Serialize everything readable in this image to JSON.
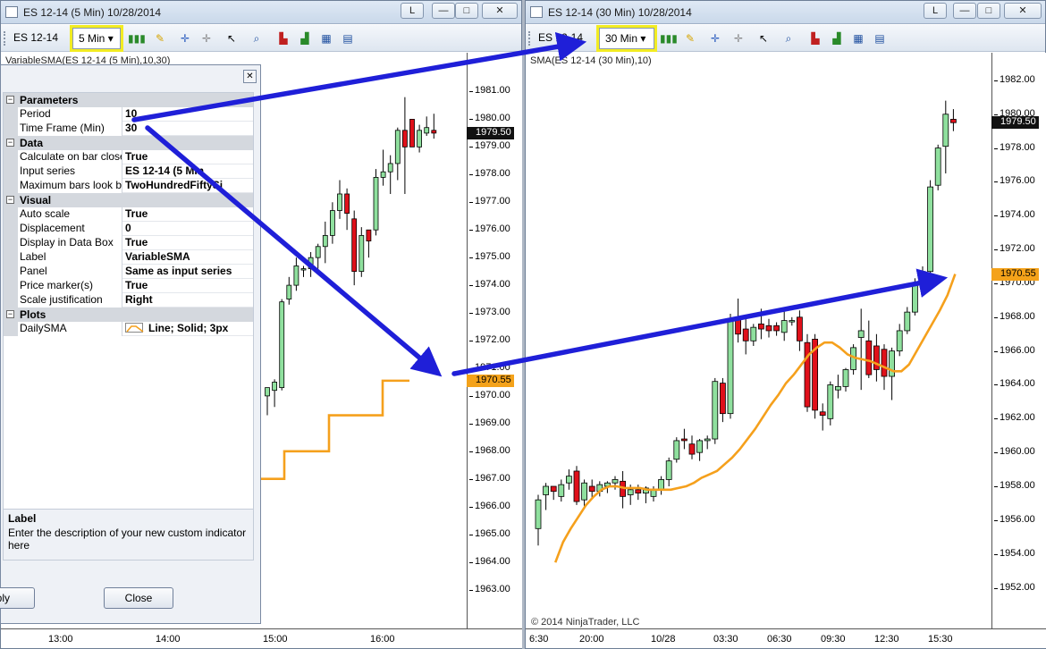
{
  "colors": {
    "bull": "#8fe09e",
    "bear": "#e0101a",
    "sma": "#f5a01c",
    "arrow": "#1f1fd8",
    "highlight": "#f2ec22"
  },
  "left_window": {
    "title": "ES 12-14 (5 Min)  10/28/2014",
    "title_buttons": {
      "layout": "L",
      "minimize": "—",
      "maximize": "□",
      "close": "✕"
    },
    "instrument": "ES 12-14",
    "timeframe": "5 Min",
    "indicator_label": "VariableSMA(ES 12-14 (5 Min),10,30)",
    "price_marker_close": "1979.50",
    "price_marker_sma": "1970.55",
    "y_ticks": [
      "1981.00",
      "1980.00",
      "1979.00",
      "1978.00",
      "1977.00",
      "1976.00",
      "1975.00",
      "1974.00",
      "1973.00",
      "1972.00",
      "1971.00",
      "1970.00",
      "1969.00",
      "1968.00",
      "1967.00",
      "1966.00",
      "1965.00",
      "1964.00",
      "1963.00"
    ],
    "x_ticks": [
      "13:00",
      "14:00",
      "15:00",
      "16:00"
    ]
  },
  "right_window": {
    "title": "ES 12-14 (30 Min)  10/28/2014",
    "title_buttons": {
      "layout": "L",
      "minimize": "—",
      "maximize": "□",
      "close": "✕"
    },
    "instrument": "ES 12-14",
    "timeframe": "30 Min",
    "indicator_label": "SMA(ES 12-14 (30 Min),10)",
    "price_marker_close": "1979.50",
    "price_marker_sma": "1970.55",
    "copyright": "© 2014 NinjaTrader, LLC",
    "y_ticks": [
      "1982.00",
      "1980.00",
      "1978.00",
      "1976.00",
      "1974.00",
      "1972.00",
      "1970.00",
      "1968.00",
      "1966.00",
      "1964.00",
      "1962.00",
      "1960.00",
      "1958.00",
      "1956.00",
      "1954.00",
      "1952.00"
    ],
    "x_ticks": [
      "6:30",
      "20:00",
      "10/28",
      "03:30",
      "06:30",
      "09:30",
      "12:30",
      "15:30"
    ]
  },
  "toolbar_icons": [
    "bar-style-icon",
    "drawing-pencil-icon",
    "crosshair-icon",
    "global-crosshair-icon",
    "pointer-icon",
    "zoom-icon",
    "indicators-icon",
    "strategies-icon",
    "chart-properties-icon",
    "data-box-icon"
  ],
  "dialog": {
    "close_label": "✕",
    "categories": [
      {
        "name": "Parameters",
        "rows": [
          {
            "label": "Period",
            "value": "10"
          },
          {
            "label": "Time Frame (Min)",
            "value": "30"
          }
        ]
      },
      {
        "name": "Data",
        "rows": [
          {
            "label": "Calculate on bar close",
            "value": "True"
          },
          {
            "label": "Input series",
            "value": "ES 12-14 (5 Min"
          },
          {
            "label": "Maximum bars look ba",
            "value": "TwoHundredFiftySi"
          }
        ]
      },
      {
        "name": "Visual",
        "rows": [
          {
            "label": "Auto scale",
            "value": "True"
          },
          {
            "label": "Displacement",
            "value": "0"
          },
          {
            "label": "Display in Data Box",
            "value": "True"
          },
          {
            "label": "Label",
            "value": "VariableSMA"
          },
          {
            "label": "Panel",
            "value": "Same as input series"
          },
          {
            "label": "Price marker(s)",
            "value": "True"
          },
          {
            "label": "Scale justification",
            "value": "Right"
          }
        ]
      },
      {
        "name": "Plots",
        "rows": [
          {
            "label": "DailySMA",
            "value": "Line; Solid; 3px"
          }
        ]
      }
    ],
    "description_title": "Label",
    "description_text": "Enter the description of your new custom indicator here",
    "apply_label": "pply",
    "close_button_label": "Close"
  },
  "chart_data": [
    {
      "type": "candlestick",
      "title": "VariableSMA(ES 12-14 (5 Min),10,30)",
      "ylim": [
        1962.5,
        1981.5
      ],
      "x_ticks": [
        "13:00",
        "14:00",
        "15:00",
        "16:00"
      ],
      "candles": [
        {
          "o": 1970.0,
          "h": 1970.3,
          "l": 1969.3,
          "c": 1970.3
        },
        {
          "o": 1970.2,
          "h": 1970.6,
          "l": 1969.6,
          "c": 1970.5
        },
        {
          "o": 1970.3,
          "h": 1973.5,
          "l": 1970.2,
          "c": 1973.4
        },
        {
          "o": 1973.5,
          "h": 1974.3,
          "l": 1973.3,
          "c": 1974.0
        },
        {
          "o": 1974.0,
          "h": 1975.0,
          "l": 1973.8,
          "c": 1974.7
        },
        {
          "o": 1974.6,
          "h": 1974.7,
          "l": 1974.3,
          "c": 1974.6
        },
        {
          "o": 1974.6,
          "h": 1975.2,
          "l": 1974.3,
          "c": 1975.0
        },
        {
          "o": 1975.0,
          "h": 1975.5,
          "l": 1974.6,
          "c": 1975.4
        },
        {
          "o": 1975.4,
          "h": 1976.3,
          "l": 1974.8,
          "c": 1975.8
        },
        {
          "o": 1975.8,
          "h": 1977.0,
          "l": 1975.5,
          "c": 1976.7
        },
        {
          "o": 1976.7,
          "h": 1977.8,
          "l": 1976.4,
          "c": 1977.3
        },
        {
          "o": 1977.3,
          "h": 1977.5,
          "l": 1976.0,
          "c": 1976.6
        },
        {
          "o": 1976.4,
          "h": 1976.7,
          "l": 1974.0,
          "c": 1974.5
        },
        {
          "o": 1974.5,
          "h": 1976.1,
          "l": 1974.3,
          "c": 1975.8
        },
        {
          "o": 1976.0,
          "h": 1976.0,
          "l": 1975.0,
          "c": 1975.6
        },
        {
          "o": 1976.0,
          "h": 1978.2,
          "l": 1975.8,
          "c": 1977.9
        },
        {
          "o": 1977.9,
          "h": 1978.9,
          "l": 1977.6,
          "c": 1978.1
        },
        {
          "o": 1978.1,
          "h": 1978.7,
          "l": 1977.3,
          "c": 1978.4
        },
        {
          "o": 1978.4,
          "h": 1979.7,
          "l": 1977.8,
          "c": 1979.6
        },
        {
          "o": 1979.6,
          "h": 1980.8,
          "l": 1977.3,
          "c": 1979.0
        },
        {
          "o": 1980.0,
          "h": 1980.0,
          "l": 1979.0,
          "c": 1979.0
        },
        {
          "o": 1979.0,
          "h": 1979.8,
          "l": 1978.8,
          "c": 1979.6
        },
        {
          "o": 1979.5,
          "h": 1980.1,
          "l": 1979.4,
          "c": 1979.7
        },
        {
          "o": 1979.6,
          "h": 1980.2,
          "l": 1979.3,
          "c": 1979.5
        }
      ],
      "sma_steps": [
        {
          "x": "14:27",
          "y": 1966.3
        },
        {
          "x": "14:27",
          "y": 1967.0
        },
        {
          "x": "15:05",
          "y": 1967.0
        },
        {
          "x": "15:05",
          "y": 1968.0
        },
        {
          "x": "15:30",
          "y": 1968.0
        },
        {
          "x": "15:30",
          "y": 1969.3
        },
        {
          "x": "16:00",
          "y": 1969.3
        },
        {
          "x": "16:00",
          "y": 1970.55
        },
        {
          "x": "16:15",
          "y": 1970.55
        }
      ]
    },
    {
      "type": "candlestick",
      "title": "SMA(ES 12-14 (30 Min),10)",
      "ylim": [
        1951.5,
        1983.0
      ],
      "x_ticks": [
        "6:30",
        "20:00",
        "10/28",
        "03:30",
        "06:30",
        "09:30",
        "12:30",
        "15:30"
      ],
      "candles": [
        {
          "o": 1955.5,
          "h": 1957.5,
          "l": 1954.5,
          "c": 1957.2
        },
        {
          "o": 1957.5,
          "h": 1958.2,
          "l": 1956.6,
          "c": 1958.0
        },
        {
          "o": 1958.0,
          "h": 1958.0,
          "l": 1957.2,
          "c": 1957.7
        },
        {
          "o": 1957.4,
          "h": 1958.4,
          "l": 1957.1,
          "c": 1958.1
        },
        {
          "o": 1958.2,
          "h": 1959.0,
          "l": 1957.8,
          "c": 1958.6
        },
        {
          "o": 1958.9,
          "h": 1959.2,
          "l": 1956.9,
          "c": 1957.1
        },
        {
          "o": 1957.2,
          "h": 1958.4,
          "l": 1956.8,
          "c": 1958.2
        },
        {
          "o": 1958.0,
          "h": 1958.4,
          "l": 1957.3,
          "c": 1957.7
        },
        {
          "o": 1957.7,
          "h": 1958.3,
          "l": 1957.4,
          "c": 1958.1
        },
        {
          "o": 1958.0,
          "h": 1958.3,
          "l": 1957.6,
          "c": 1958.2
        },
        {
          "o": 1958.2,
          "h": 1958.6,
          "l": 1957.8,
          "c": 1958.4
        },
        {
          "o": 1958.3,
          "h": 1958.9,
          "l": 1956.7,
          "c": 1957.4
        },
        {
          "o": 1957.5,
          "h": 1958.1,
          "l": 1956.9,
          "c": 1957.8
        },
        {
          "o": 1957.8,
          "h": 1958.1,
          "l": 1957.2,
          "c": 1957.6
        },
        {
          "o": 1957.6,
          "h": 1958.0,
          "l": 1957.0,
          "c": 1957.9
        },
        {
          "o": 1957.4,
          "h": 1958.0,
          "l": 1957.1,
          "c": 1957.8
        },
        {
          "o": 1957.8,
          "h": 1958.6,
          "l": 1957.5,
          "c": 1958.4
        },
        {
          "o": 1958.4,
          "h": 1959.7,
          "l": 1958.0,
          "c": 1959.5
        },
        {
          "o": 1959.6,
          "h": 1960.9,
          "l": 1959.4,
          "c": 1960.7
        },
        {
          "o": 1960.8,
          "h": 1961.4,
          "l": 1960.2,
          "c": 1960.7
        },
        {
          "o": 1960.5,
          "h": 1961.0,
          "l": 1959.6,
          "c": 1959.9
        },
        {
          "o": 1960.0,
          "h": 1960.8,
          "l": 1959.5,
          "c": 1960.7
        },
        {
          "o": 1960.7,
          "h": 1961.0,
          "l": 1960.2,
          "c": 1960.8
        },
        {
          "o": 1960.8,
          "h": 1964.4,
          "l": 1960.5,
          "c": 1964.2
        },
        {
          "o": 1964.1,
          "h": 1964.4,
          "l": 1961.8,
          "c": 1962.3
        },
        {
          "o": 1962.3,
          "h": 1968.2,
          "l": 1962.0,
          "c": 1967.8
        },
        {
          "o": 1967.9,
          "h": 1969.1,
          "l": 1966.5,
          "c": 1967.0
        },
        {
          "o": 1967.3,
          "h": 1968.0,
          "l": 1965.8,
          "c": 1966.6
        },
        {
          "o": 1966.6,
          "h": 1967.6,
          "l": 1966.3,
          "c": 1967.4
        },
        {
          "o": 1967.6,
          "h": 1968.5,
          "l": 1966.7,
          "c": 1967.3
        },
        {
          "o": 1967.5,
          "h": 1967.9,
          "l": 1966.8,
          "c": 1967.2
        },
        {
          "o": 1967.5,
          "h": 1967.7,
          "l": 1966.9,
          "c": 1967.2
        },
        {
          "o": 1967.1,
          "h": 1968.5,
          "l": 1966.6,
          "c": 1967.8
        },
        {
          "o": 1967.8,
          "h": 1968.0,
          "l": 1967.5,
          "c": 1967.8
        },
        {
          "o": 1968.0,
          "h": 1968.4,
          "l": 1966.0,
          "c": 1966.6
        },
        {
          "o": 1966.5,
          "h": 1967.0,
          "l": 1962.4,
          "c": 1962.7
        },
        {
          "o": 1966.7,
          "h": 1967.0,
          "l": 1962.0,
          "c": 1962.5
        },
        {
          "o": 1962.4,
          "h": 1962.9,
          "l": 1961.3,
          "c": 1962.2
        },
        {
          "o": 1962.0,
          "h": 1964.2,
          "l": 1961.6,
          "c": 1964.0
        },
        {
          "o": 1963.7,
          "h": 1964.6,
          "l": 1963.2,
          "c": 1963.9
        },
        {
          "o": 1963.9,
          "h": 1965.0,
          "l": 1963.6,
          "c": 1964.9
        },
        {
          "o": 1964.9,
          "h": 1966.4,
          "l": 1964.6,
          "c": 1966.2
        },
        {
          "o": 1966.8,
          "h": 1968.5,
          "l": 1963.7,
          "c": 1967.2
        },
        {
          "o": 1966.6,
          "h": 1967.8,
          "l": 1964.4,
          "c": 1964.6
        },
        {
          "o": 1966.3,
          "h": 1967.0,
          "l": 1964.2,
          "c": 1964.9
        },
        {
          "o": 1966.1,
          "h": 1966.4,
          "l": 1963.7,
          "c": 1964.5
        },
        {
          "o": 1964.5,
          "h": 1966.2,
          "l": 1963.1,
          "c": 1966.0
        },
        {
          "o": 1966.0,
          "h": 1967.6,
          "l": 1965.7,
          "c": 1967.2
        },
        {
          "o": 1967.2,
          "h": 1968.6,
          "l": 1967.0,
          "c": 1968.3
        },
        {
          "o": 1968.3,
          "h": 1970.3,
          "l": 1968.1,
          "c": 1970.0
        },
        {
          "o": 1970.1,
          "h": 1971.0,
          "l": 1969.7,
          "c": 1970.7
        },
        {
          "o": 1970.7,
          "h": 1976.1,
          "l": 1970.5,
          "c": 1975.7
        },
        {
          "o": 1975.8,
          "h": 1978.2,
          "l": 1975.5,
          "c": 1978.0
        },
        {
          "o": 1978.1,
          "h": 1980.8,
          "l": 1976.5,
          "c": 1980.0
        },
        {
          "o": 1979.7,
          "h": 1980.3,
          "l": 1979.0,
          "c": 1979.5
        }
      ],
      "sma": [
        1953.5,
        1954.7,
        1955.5,
        1956.2,
        1956.9,
        1957.4,
        1957.8,
        1958.0,
        1958.0,
        1957.9,
        1957.9,
        1957.9,
        1957.8,
        1957.8,
        1957.8,
        1957.8,
        1957.9,
        1958.0,
        1958.2,
        1958.5,
        1958.7,
        1958.9,
        1959.3,
        1959.7,
        1960.2,
        1960.8,
        1961.4,
        1962.1,
        1962.8,
        1963.4,
        1964.1,
        1964.6,
        1965.2,
        1965.8,
        1966.2,
        1966.5,
        1966.5,
        1966.2,
        1965.8,
        1965.6,
        1965.5,
        1965.4,
        1965.2,
        1965.0,
        1964.8,
        1964.8,
        1965.2,
        1966.0,
        1966.8,
        1967.6,
        1968.4,
        1969.3,
        1970.55
      ]
    }
  ]
}
